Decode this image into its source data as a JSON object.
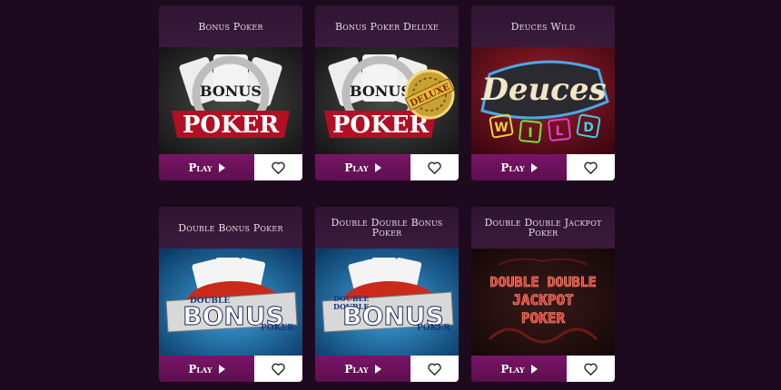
{
  "games": [
    {
      "title": "Bonus Poker",
      "play_label": "Play",
      "art": {
        "line1": "BONUS",
        "line2": "POKER"
      }
    },
    {
      "title": "Bonus Poker Deluxe",
      "play_label": "Play",
      "art": {
        "line1": "BONUS",
        "line2": "POKER",
        "badge": "DELUXE"
      }
    },
    {
      "title": "Deuces Wild",
      "play_label": "Play",
      "art": {
        "line1": "Deuces",
        "letters": [
          "W",
          "I",
          "L",
          "D"
        ]
      }
    },
    {
      "title": "Double Bonus Poker",
      "play_label": "Play",
      "art": {
        "line1": "DOUBLE",
        "line2": "BONUS",
        "line3": "POKER"
      }
    },
    {
      "title": "Double Double Bonus Poker",
      "play_label": "Play",
      "art": {
        "line1": "DOUBLE",
        "line1b": "DOUBLE",
        "line2": "BONUS",
        "line3": "POKER"
      }
    },
    {
      "title": "Double Double Jackpot Poker",
      "play_label": "Play",
      "art": {
        "line1": "DOUBLE DOUBLE",
        "line2": "JACKPOT",
        "line3": "POKER"
      }
    }
  ],
  "icons": {
    "play": "play-icon",
    "favorite": "heart-icon"
  },
  "colors": {
    "background": "#1e0a1e",
    "play_button": "#6e1360",
    "title_bar": "#341737",
    "favorite_button": "#ffffff"
  }
}
